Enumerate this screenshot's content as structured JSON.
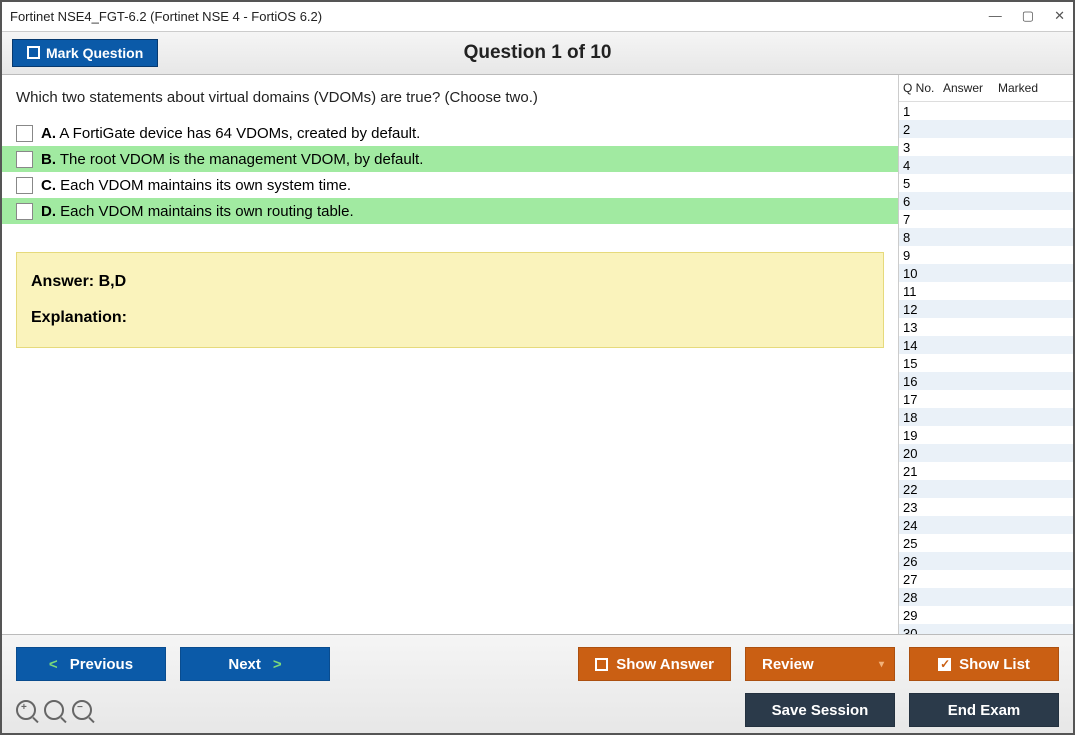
{
  "window": {
    "title": "Fortinet NSE4_FGT-6.2 (Fortinet NSE 4 - FortiOS 6.2)"
  },
  "toolbar": {
    "mark": "Mark Question"
  },
  "heading": "Question 1 of 10",
  "question": {
    "text": "Which two statements about virtual domains (VDOMs) are true? (Choose two.)"
  },
  "choices": [
    {
      "letter": "A.",
      "text": "A FortiGate device has 64 VDOMs, created by default.",
      "correct": false
    },
    {
      "letter": "B.",
      "text": "The root VDOM is the management VDOM, by default.",
      "correct": true
    },
    {
      "letter": "C.",
      "text": "Each VDOM maintains its own system time.",
      "correct": false
    },
    {
      "letter": "D.",
      "text": "Each VDOM maintains its own routing table.",
      "correct": true
    }
  ],
  "answer": {
    "title": "Answer: B,D",
    "explanation_label": "Explanation:"
  },
  "side": {
    "headers": {
      "qno": "Q No.",
      "answer": "Answer",
      "marked": "Marked"
    },
    "rows": 30
  },
  "footer": {
    "previous": "Previous",
    "next": "Next",
    "show_answer": "Show Answer",
    "review": "Review",
    "show_list": "Show List",
    "save_session": "Save Session",
    "end_exam": "End Exam"
  }
}
